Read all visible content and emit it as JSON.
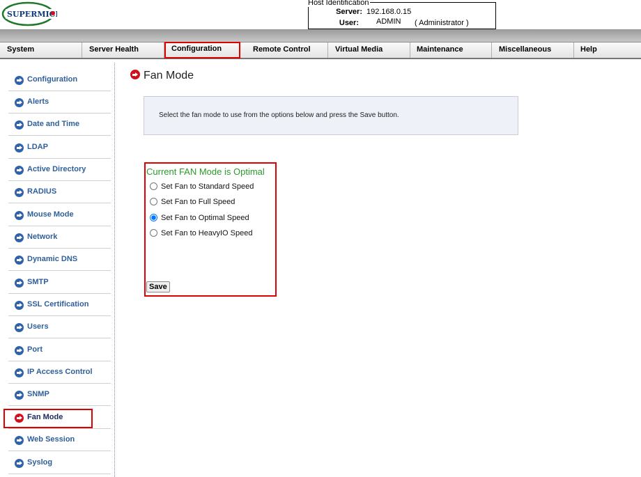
{
  "header": {
    "logo_text": "SUPERMICRO",
    "host_legend": "Host Identification",
    "server_label": "Server:",
    "server_value": "192.168.0.15",
    "user_label": "User:",
    "user_value": "ADMIN",
    "user_role": "( Administrator )"
  },
  "menu": {
    "items": [
      "System",
      "Server Health",
      "Configuration",
      "Remote Control",
      "Virtual Media",
      "Maintenance",
      "Miscellaneous",
      "Help"
    ],
    "selected": "Configuration"
  },
  "sidebar": {
    "items": [
      "Configuration",
      "Alerts",
      "Date and Time",
      "LDAP",
      "Active Directory",
      "RADIUS",
      "Mouse Mode",
      "Network",
      "Dynamic DNS",
      "SMTP",
      "SSL Certification",
      "Users",
      "Port",
      "IP Access Control",
      "SNMP",
      "Fan Mode",
      "Web Session",
      "Syslog"
    ],
    "active": "Fan Mode"
  },
  "main": {
    "title": "Fan Mode",
    "info": "Select the fan mode to use from the options below and press the Save button.",
    "status": "Current FAN Mode is Optimal",
    "options": [
      "Set Fan to Standard Speed",
      "Set Fan to Full Speed",
      "Set Fan to Optimal Speed",
      "Set Fan to HeavyIO Speed"
    ],
    "selected_option": "Set Fan to Optimal Speed",
    "save_label": "Save"
  },
  "colors": {
    "highlight": "#e00000",
    "sidebar_link": "#2f5f9a",
    "status_green": "#2a9a2a",
    "active_icon": "#d0101a"
  },
  "icons": {
    "nav_arrow": "circle-right-arrow-icon"
  }
}
